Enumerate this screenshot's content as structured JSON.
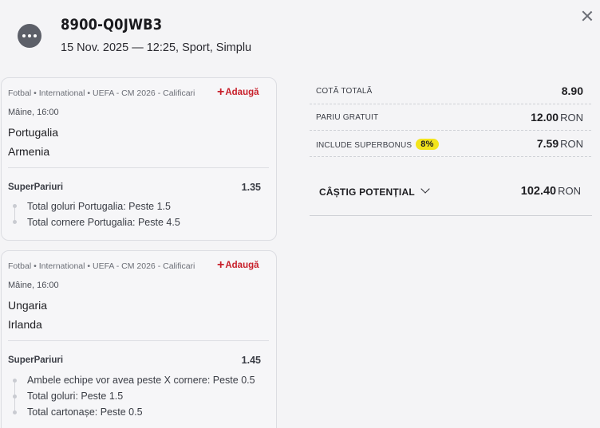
{
  "header": {
    "ticket_id": "8900-Q0JWB3",
    "meta": "15 Nov. 2025 — 12:25, Sport, Simplu"
  },
  "events": [
    {
      "path": "Fotbal • International • UEFA - CM 2026 - Calificari",
      "add_label": "Adaugă",
      "time": "Mâine, 16:00",
      "home": "Portugalia",
      "away": "Armenia",
      "market": "SuperPariuri",
      "odds": "1.35",
      "selections": [
        "Total goluri Portugalia: Peste 1.5",
        "Total cornere Portugalia: Peste 4.5"
      ]
    },
    {
      "path": "Fotbal • International • UEFA - CM 2026 - Calificari",
      "add_label": "Adaugă",
      "time": "Mâine, 16:00",
      "home": "Ungaria",
      "away": "Irlanda",
      "market": "SuperPariuri",
      "odds": "1.45",
      "selections": [
        "Ambele echipe vor avea peste X cornere: Peste 0.5",
        "Total goluri: Peste 1.5",
        "Total cartonașe: Peste 0.5"
      ]
    }
  ],
  "summary": {
    "total_odds_label": "COTĂ TOTALĂ",
    "total_odds": "8.90",
    "free_bet_label": "PARIU GRATUIT",
    "free_bet": "12.00",
    "superbonus_label": "INCLUDE SUPERBONUS",
    "superbonus_pct": "8%",
    "superbonus_value": "7.59",
    "currency": "RON",
    "potential_label": "CÂȘTIG POTENȚIAL",
    "potential_value": "102.40"
  },
  "colors": {
    "accent_red": "#c8202b",
    "badge_yellow": "#f3e41b"
  }
}
